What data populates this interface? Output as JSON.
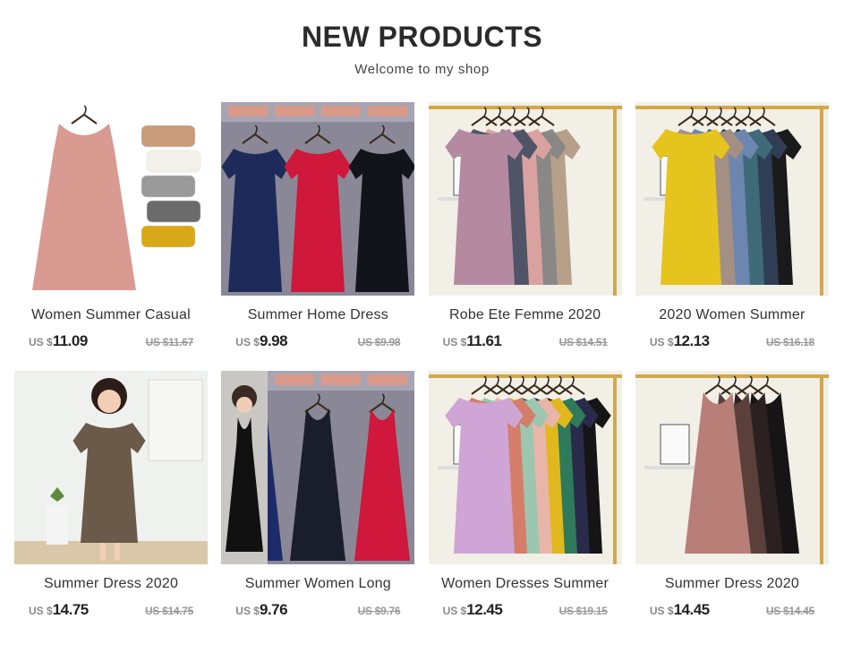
{
  "header": {
    "title": "NEW PRODUCTS",
    "subtitle": "Welcome to my shop"
  },
  "products": [
    {
      "name": "Women Summer Casual",
      "currency": "US $",
      "price": "11.09",
      "old_price": "US $11.67",
      "image": "pink-sleeveless-dress",
      "bg": "#ffffff",
      "colors": [
        "#d99a92",
        "#c89b7a",
        "#f3f0ea",
        "#9a9a9a",
        "#6b6b6b",
        "#d9a818"
      ]
    },
    {
      "name": "Summer Home Dress",
      "currency": "US $",
      "price": "9.98",
      "old_price": "US $9.98",
      "image": "three-dresses-on-hangers",
      "bg": "#8a8896",
      "colors": [
        "#1e2b5a",
        "#d0173c",
        "#13131c"
      ]
    },
    {
      "name": "Robe Ete Femme 2020",
      "currency": "US $",
      "price": "11.61",
      "old_price": "US $14.51",
      "image": "raglan-dresses-rack",
      "bg": "#f2efe6",
      "colors": [
        "#b58aa0",
        "#4f5467",
        "#d9a2a0",
        "#8a8886",
        "#b7a08a"
      ]
    },
    {
      "name": "2020 Women Summer",
      "currency": "US $",
      "price": "12.13",
      "old_price": "US $16.18",
      "image": "yellow-tshirt-dresses-rack",
      "bg": "#f2efe6",
      "colors": [
        "#e5c41e",
        "#a38f84",
        "#6c86b0",
        "#3f6b78",
        "#2f3e55",
        "#1a1a1a"
      ]
    },
    {
      "name": "Summer Dress 2020",
      "currency": "US $",
      "price": "14.75",
      "old_price": "US $14.75",
      "image": "model-brown-dress",
      "bg": "#eef0ee",
      "colors": [
        "#6b5a4a"
      ]
    },
    {
      "name": "Summer Women Long",
      "currency": "US $",
      "price": "9.76",
      "old_price": "US $9.76",
      "image": "sleeveless-long-dresses",
      "bg": "#8a8896",
      "colors": [
        "#1e2b6a",
        "#1a1d2a",
        "#d0173c"
      ]
    },
    {
      "name": "Women Dresses Summer",
      "currency": "US $",
      "price": "12.45",
      "old_price": "US $19.15",
      "image": "lilac-dresses-rack",
      "bg": "#f2efe6",
      "colors": [
        "#cfa5d6",
        "#d47d68",
        "#9cc6b0",
        "#e8b5a8",
        "#e0b81e",
        "#2f7a5a",
        "#2a2a4a",
        "#151515"
      ]
    },
    {
      "name": "Summer Dress 2020",
      "currency": "US $",
      "price": "14.45",
      "old_price": "US $14.45",
      "image": "tank-dresses-rack",
      "bg": "#f2efe6",
      "colors": [
        "#b77f78",
        "#5a3f3a",
        "#2a2120",
        "#161414"
      ]
    }
  ]
}
